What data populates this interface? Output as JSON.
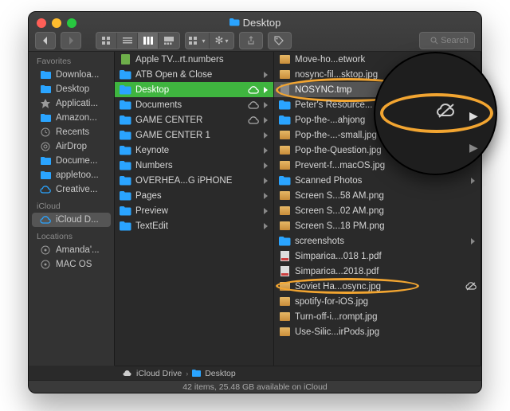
{
  "window": {
    "title": "Desktop"
  },
  "toolbar": {
    "search_placeholder": "Search"
  },
  "sidebar": {
    "groups": [
      {
        "label": "Favorites",
        "items": [
          {
            "label": "Downloa...",
            "icon": "folder"
          },
          {
            "label": "Desktop",
            "icon": "folder"
          },
          {
            "label": "Applicati...",
            "icon": "app"
          },
          {
            "label": "Amazon...",
            "icon": "folder"
          },
          {
            "label": "Recents",
            "icon": "clock"
          },
          {
            "label": "AirDrop",
            "icon": "airdrop"
          },
          {
            "label": "Docume...",
            "icon": "folder"
          },
          {
            "label": "appletoo...",
            "icon": "folder"
          },
          {
            "label": "Creative...",
            "icon": "cloud"
          }
        ]
      },
      {
        "label": "iCloud",
        "items": [
          {
            "label": "iCloud D...",
            "icon": "cloud",
            "selected": true
          }
        ]
      },
      {
        "label": "Locations",
        "items": [
          {
            "label": "Amanda'...",
            "icon": "disk"
          },
          {
            "label": "MAC OS",
            "icon": "disk"
          }
        ]
      }
    ]
  },
  "col1": [
    {
      "name": "Apple TV...rt.numbers",
      "type": "file",
      "iconColor": "#6eaf4a"
    },
    {
      "name": "ATB Open & Close",
      "type": "folder",
      "chev": true
    },
    {
      "name": "Desktop",
      "type": "folder",
      "badge": "cloud",
      "chev": true,
      "selected": true
    },
    {
      "name": "Documents",
      "type": "folder",
      "badge": "cloud",
      "chev": true
    },
    {
      "name": "GAME CENTER",
      "type": "folder",
      "badge": "cloud",
      "chev": true
    },
    {
      "name": "GAME CENTER 1",
      "type": "folder",
      "chev": true
    },
    {
      "name": "Keynote",
      "type": "folder",
      "chev": true
    },
    {
      "name": "Numbers",
      "type": "folder",
      "chev": true
    },
    {
      "name": "OVERHEA...G iPHONE",
      "type": "folder",
      "chev": true
    },
    {
      "name": "Pages",
      "type": "folder",
      "chev": true
    },
    {
      "name": "Preview",
      "type": "folder",
      "chev": true
    },
    {
      "name": "TextEdit",
      "type": "folder",
      "chev": true
    }
  ],
  "col2": [
    {
      "name": "Move-ho...etwork",
      "type": "img"
    },
    {
      "name": "nosync-fil...sktop.jpg",
      "type": "img"
    },
    {
      "name": "NOSYNC.tmp",
      "type": "tmp",
      "sel2": true,
      "highlight": true
    },
    {
      "name": "Peter's Resource...",
      "type": "folder",
      "chev": true
    },
    {
      "name": "Pop-the-...ahjong",
      "type": "folder",
      "chev": true
    },
    {
      "name": "Pop-the-...-small.jpg",
      "type": "img"
    },
    {
      "name": "Pop-the-Question.jpg",
      "type": "img"
    },
    {
      "name": "Prevent-f...macOS.jpg",
      "type": "img"
    },
    {
      "name": "Scanned Photos",
      "type": "folder",
      "chev": true
    },
    {
      "name": "Screen S...58 AM.png",
      "type": "img"
    },
    {
      "name": "Screen S...02 AM.png",
      "type": "img"
    },
    {
      "name": "Screen S...18 PM.png",
      "type": "img"
    },
    {
      "name": "screenshots",
      "type": "folder",
      "chev": true
    },
    {
      "name": "Simparica...018 1.pdf",
      "type": "pdf"
    },
    {
      "name": "Simparica...2018.pdf",
      "type": "pdf"
    },
    {
      "name": "Soviet Ha...osync.jpg",
      "type": "img",
      "badge": "cloud-slash",
      "highlight2": true
    },
    {
      "name": "spotify-for-iOS.jpg",
      "type": "img"
    },
    {
      "name": "Turn-off-i...rompt.jpg",
      "type": "img"
    },
    {
      "name": "Use-Silic...irPods.jpg",
      "type": "img"
    }
  ],
  "path": {
    "seg1": "iCloud Drive",
    "seg2": "Desktop"
  },
  "status": "42 items, 25.48 GB available on iCloud"
}
